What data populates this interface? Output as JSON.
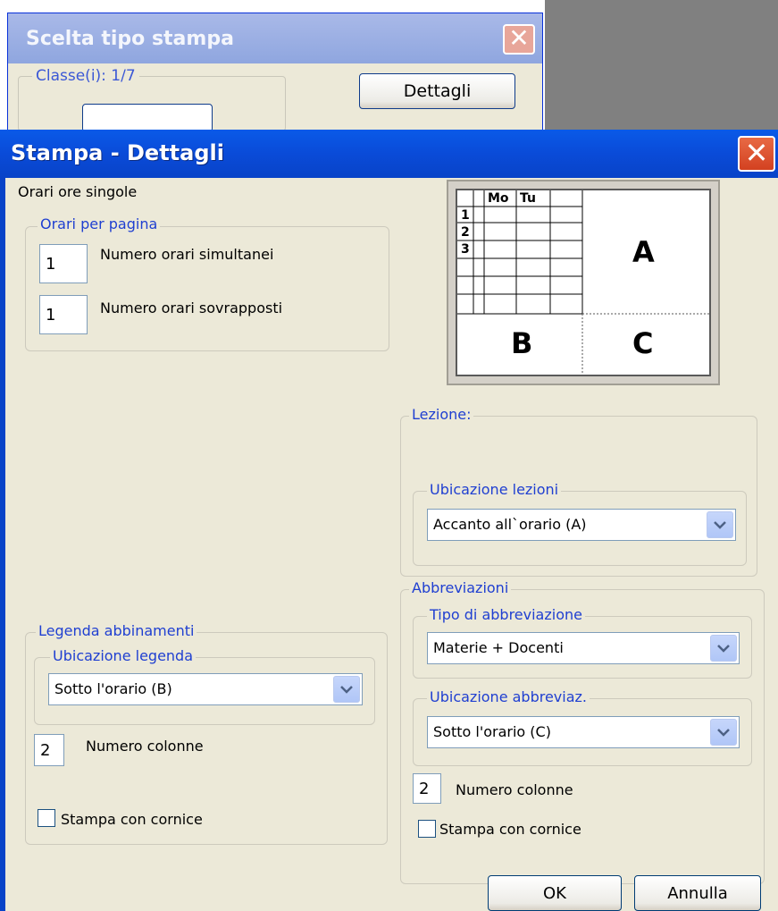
{
  "back_window": {
    "title": "Scelta tipo stampa",
    "group_label": "Classe(i): 1/7",
    "details_button": "Dettagli"
  },
  "dialog": {
    "title": "Stampa - Dettagli",
    "section_label": "Orari ore singole",
    "orari_per_pagina": {
      "group_label": "Orari per pagina",
      "simultanei_value": "1",
      "simultanei_label": "Numero orari simultanei",
      "sovrapposti_value": "1",
      "sovrapposti_label": "Numero orari sovrapposti"
    },
    "preview": {
      "col1": "Mo",
      "col2": "Tu",
      "row1": "1",
      "row2": "2",
      "row3": "3",
      "area_a": "A",
      "area_b": "B",
      "area_c": "C"
    },
    "lezione": {
      "group_label": "Lezione:",
      "ubicazione_group": "Ubicazione lezioni",
      "ubicazione_value": "Accanto all`orario (A)"
    },
    "abbreviazioni": {
      "group_label": "Abbreviazioni",
      "tipo_group": "Tipo di abbreviazione",
      "tipo_value": "Materie + Docenti",
      "ubicazione_group": "Ubicazione abbreviaz.",
      "ubicazione_value": "Sotto l'orario (C)",
      "colonne_value": "2",
      "colonne_label": "Numero colonne",
      "cornice_label": "Stampa con cornice"
    },
    "legenda": {
      "group_label": "Legenda abbinamenti",
      "ubicazione_group": "Ubicazione legenda",
      "ubicazione_value": "Sotto l'orario (B)",
      "colonne_value": "2",
      "colonne_label": "Numero colonne",
      "cornice_label": "Stampa con cornice"
    },
    "buttons": {
      "ok": "OK",
      "cancel": "Annulla"
    }
  },
  "colors": {
    "titlebar": "#0a4bd8",
    "dialog_bg": "#ece9d8",
    "group_label": "#1f3fd1",
    "close_button": "#d34120"
  }
}
